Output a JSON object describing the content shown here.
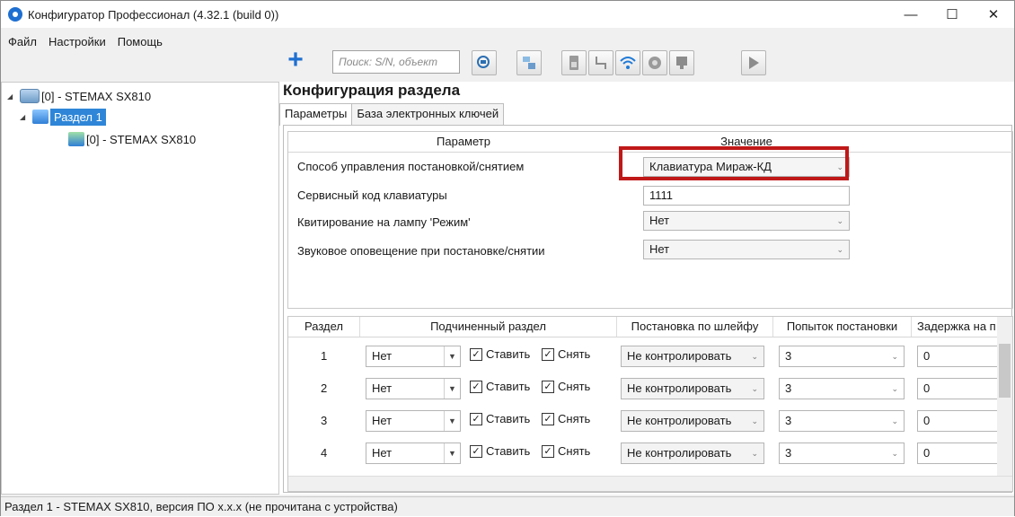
{
  "window": {
    "title": "Конфигуратор Профессионал (4.32.1 (build 0))"
  },
  "menu": {
    "items": [
      "Файл",
      "Настройки",
      "Помощь"
    ]
  },
  "toolbar": {
    "search_placeholder": "Поиск: S/N, объект"
  },
  "tree": {
    "root": "[0] - STEMAX SX810",
    "section": "Раздел 1",
    "child": "[0] - STEMAX SX810"
  },
  "main": {
    "title": "Конфигурация раздела",
    "tabs": [
      "Параметры",
      "База электронных ключей"
    ],
    "params_headers": {
      "param": "Параметр",
      "value": "Значение"
    },
    "params": [
      {
        "label": "Способ управления постановкой/снятием",
        "value": "Клавиатура Мираж-КД",
        "type": "combo"
      },
      {
        "label": "Сервисный код клавиатуры",
        "value": "1111",
        "type": "text"
      },
      {
        "label": "Квитирование на лампу 'Режим'",
        "value": "Нет",
        "type": "combo"
      },
      {
        "label": "Звуковое оповещение при постановке/снятии",
        "value": "Нет",
        "type": "combo"
      }
    ],
    "table": {
      "headers": [
        "Раздел",
        "Подчиненный раздел",
        "Постановка по шлейфу",
        "Попыток постановки",
        "Задержка на п"
      ],
      "set_label": "Ставить",
      "unset_label": "Снять",
      "rows": [
        {
          "section": "1",
          "sub": "Нет",
          "loop": "Не контролировать",
          "tries": "3",
          "delay": "0"
        },
        {
          "section": "2",
          "sub": "Нет",
          "loop": "Не контролировать",
          "tries": "3",
          "delay": "0"
        },
        {
          "section": "3",
          "sub": "Нет",
          "loop": "Не контролировать",
          "tries": "3",
          "delay": "0"
        },
        {
          "section": "4",
          "sub": "Нет",
          "loop": "Не контролировать",
          "tries": "3",
          "delay": "0"
        }
      ]
    }
  },
  "status": {
    "text": "Раздел 1 - STEMAX SX810, версия ПО x.x.x (не прочитана с устройства)"
  },
  "colors": {
    "accent": "#2f86d8",
    "highlight": "#c01818"
  }
}
